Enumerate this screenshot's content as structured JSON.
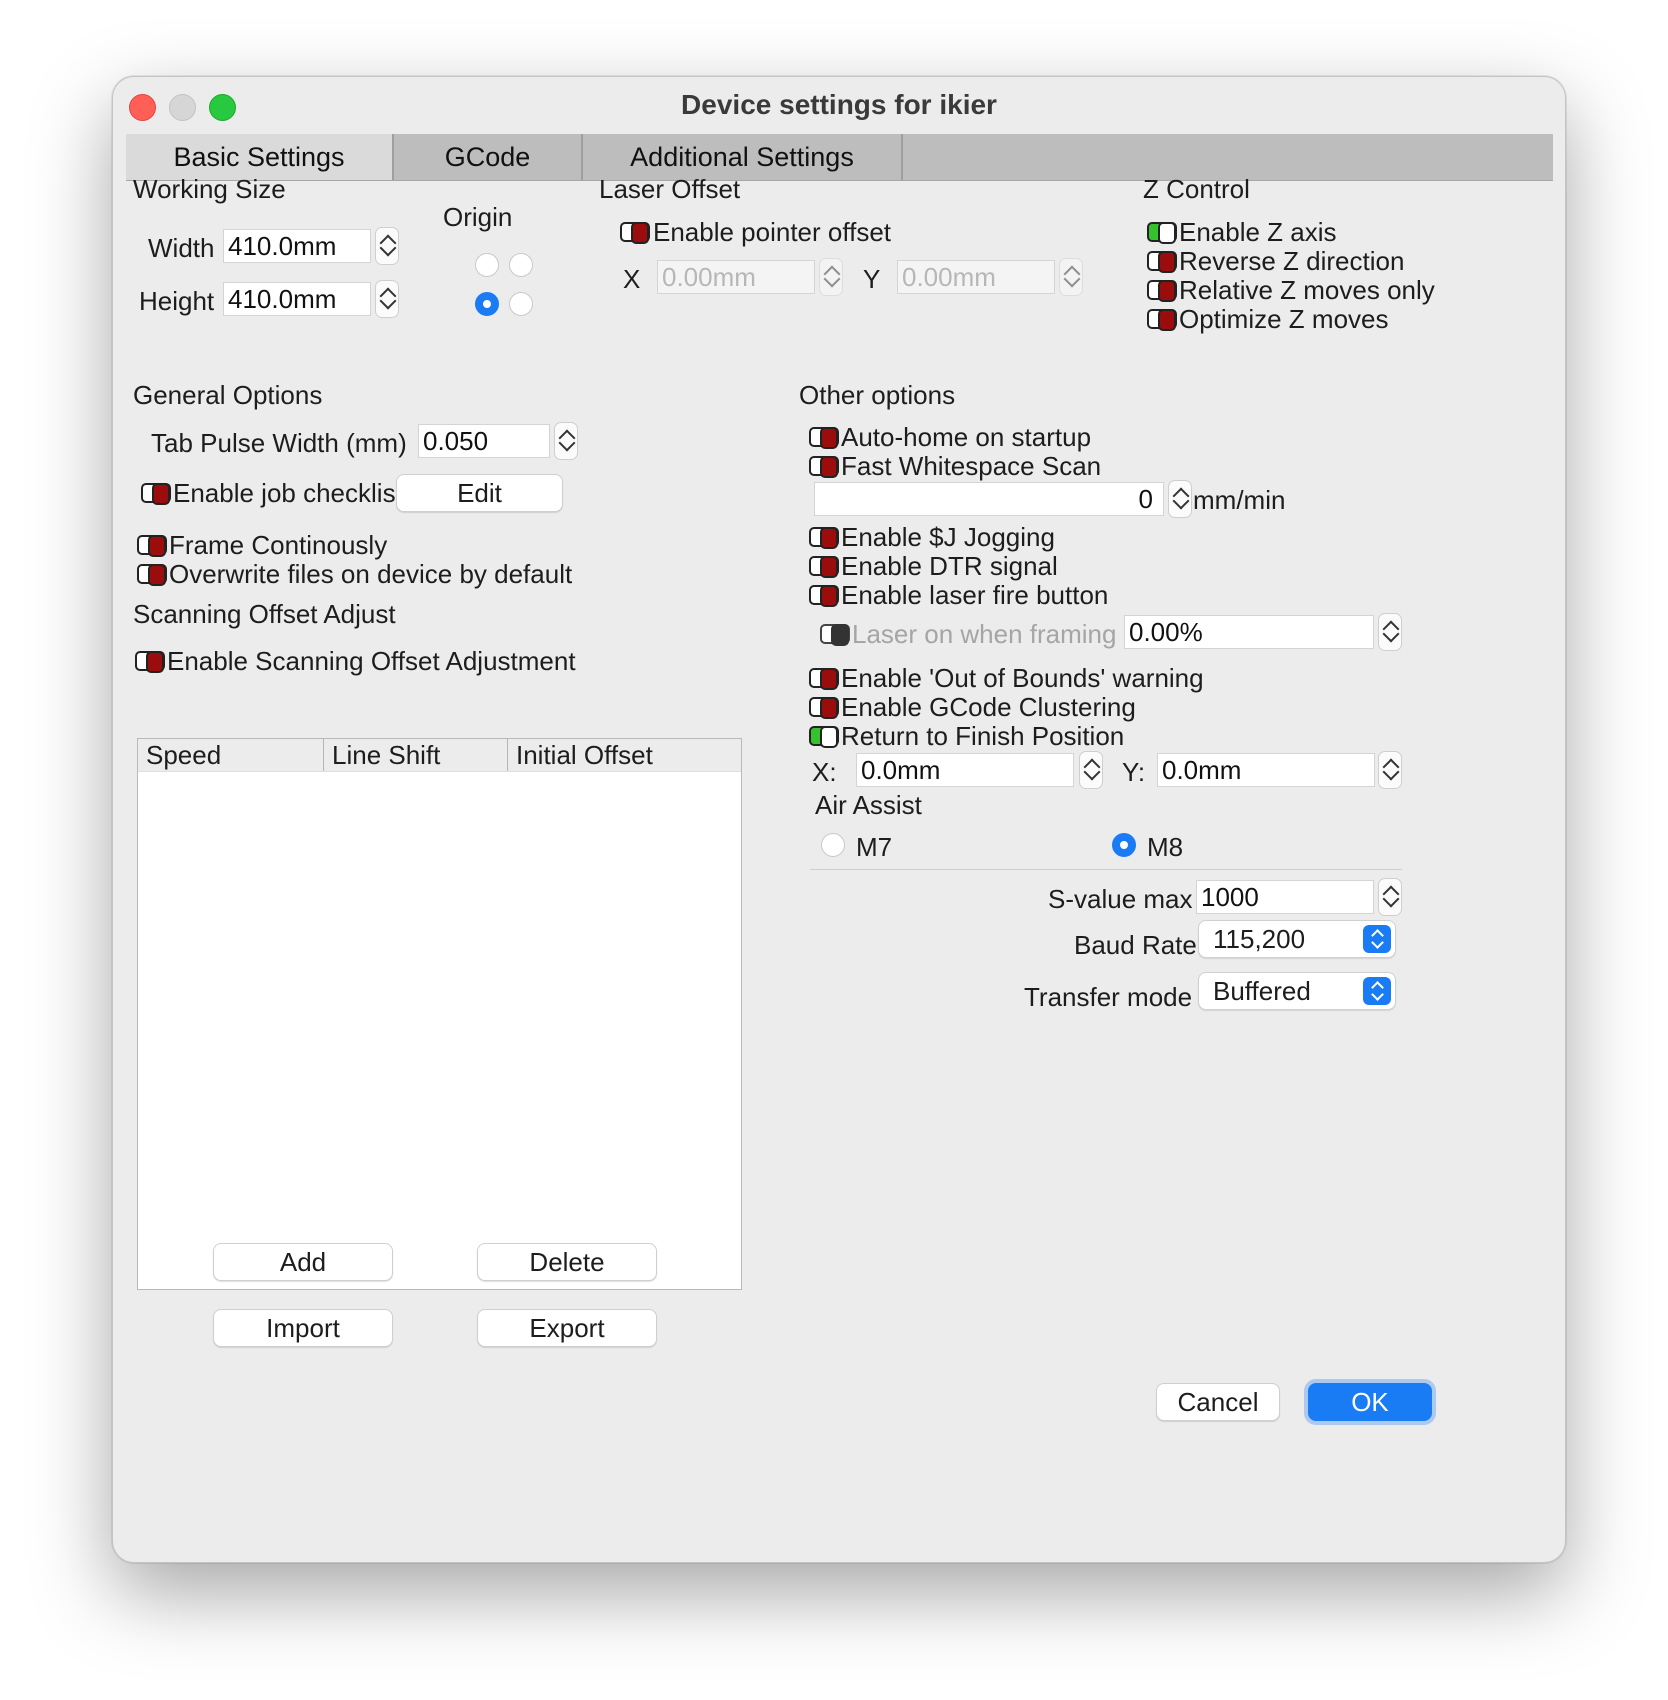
{
  "window": {
    "title": "Device settings for ikier"
  },
  "tabs": [
    {
      "label": "Basic Settings",
      "active": true
    },
    {
      "label": "GCode",
      "active": false
    },
    {
      "label": "Additional Settings",
      "active": false
    }
  ],
  "working_size": {
    "heading": "Working Size",
    "width_label": "Width",
    "width_value": "410.0mm",
    "height_label": "Height",
    "height_value": "410.0mm"
  },
  "origin": {
    "label": "Origin",
    "selected": "bottom-left"
  },
  "laser_offset": {
    "heading": "Laser Offset",
    "enable_label": "Enable pointer offset",
    "enable_on": false,
    "x_label": "X",
    "x_value": "0.00mm",
    "y_label": "Y",
    "y_value": "0.00mm"
  },
  "z_control": {
    "heading": "Z Control",
    "options": [
      {
        "label": "Enable Z axis",
        "on": true
      },
      {
        "label": "Reverse Z direction",
        "on": false
      },
      {
        "label": "Relative Z moves only",
        "on": false
      },
      {
        "label": "Optimize Z moves",
        "on": false
      }
    ]
  },
  "general_options": {
    "heading": "General Options",
    "tab_pulse_label": "Tab Pulse Width (mm)",
    "tab_pulse_value": "0.050",
    "job_checklist_label": "Enable job checklist",
    "job_checklist_on": false,
    "edit_button": "Edit",
    "frame_continuously_label": "Frame Continously",
    "frame_continuously_on": false,
    "overwrite_label": "Overwrite files on device by default",
    "overwrite_on": false
  },
  "scanning_offset": {
    "heading": "Scanning Offset Adjust",
    "enable_label": "Enable Scanning Offset Adjustment",
    "enable_on": false,
    "columns": [
      "Speed",
      "Line Shift",
      "Initial Offset"
    ],
    "rows": [],
    "add_button": "Add",
    "delete_button": "Delete",
    "import_button": "Import",
    "export_button": "Export"
  },
  "other_options": {
    "heading": "Other options",
    "auto_home_label": "Auto-home on startup",
    "fast_whitespace_label": "Fast Whitespace Scan",
    "fast_whitespace_value": "0",
    "fast_whitespace_unit": "mm/min",
    "sj_jogging_label": "Enable $J Jogging",
    "dtr_label": "Enable DTR signal",
    "laser_fire_label": "Enable laser fire button",
    "laser_on_framing_label": "Laser on when framing",
    "laser_on_framing_value": "0.00%",
    "out_of_bounds_label": "Enable 'Out of Bounds' warning",
    "gcode_clustering_label": "Enable GCode Clustering",
    "return_finish_label": "Return to Finish Position",
    "return_finish_on": true,
    "finish_x_label": "X:",
    "finish_x_value": "0.0mm",
    "finish_y_label": "Y:",
    "finish_y_value": "0.0mm",
    "air_assist_label": "Air Assist",
    "m7_label": "M7",
    "m8_label": "M8",
    "air_assist_selected": "M8",
    "s_value_label": "S-value max",
    "s_value": "1000",
    "baud_rate_label": "Baud Rate",
    "baud_rate": "115,200",
    "transfer_mode_label": "Transfer mode",
    "transfer_mode": "Buffered"
  },
  "footer": {
    "cancel_button": "Cancel",
    "ok_button": "OK"
  },
  "colors": {
    "accent": "#1a7cf5",
    "toggle_on": "#35c22e",
    "toggle_off": "#9b0c0c"
  }
}
